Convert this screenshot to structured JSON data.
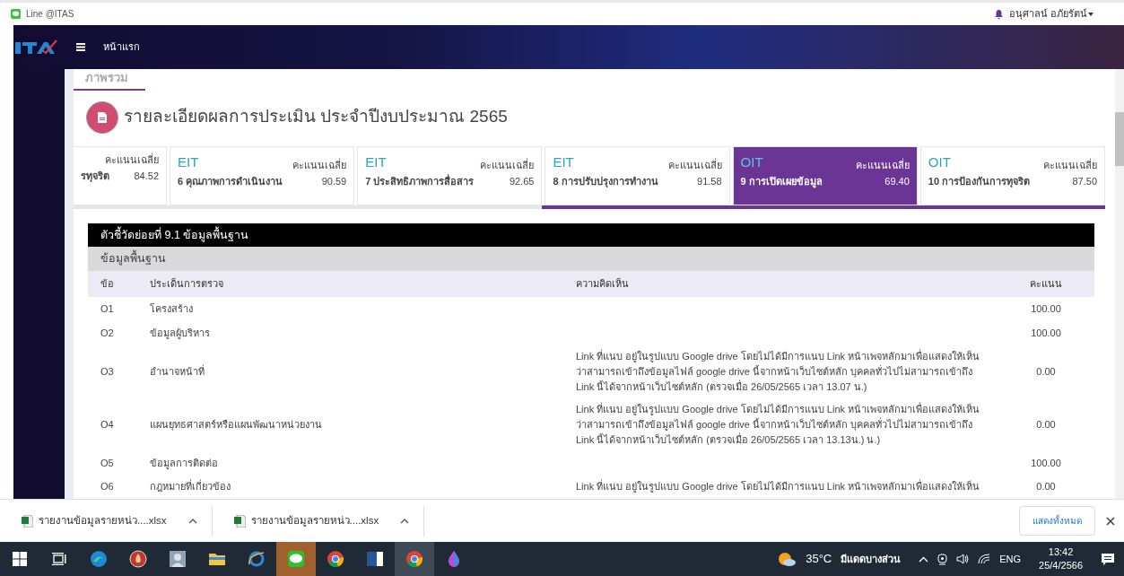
{
  "browser_bar": {
    "bookmark": "Line @ITAS",
    "user": "อนุศาลน์ อภัยรัตน์"
  },
  "navbar": {
    "menu": "หน้าแรก"
  },
  "tabs": [
    {
      "label": "ภาพรวม",
      "selected": true
    }
  ],
  "heading": "รายละเอียดผลการประเมิน ประจำปีงบประมาณ 2565",
  "cards": [
    {
      "name": "รทุจริต",
      "score_label": "คะแนนเฉลี่ย",
      "score": "84.52",
      "selected": false
    },
    {
      "kind_label": "EIT",
      "name": "6 คุณภาพการดำเนินงาน",
      "score_label": "คะแนนเฉลี่ย",
      "score": "90.59",
      "selected": false
    },
    {
      "kind_label": "EIT",
      "name": "7 ประสิทธิภาพการสื่อสาร",
      "score_label": "คะแนนเฉลี่ย",
      "score": "92.65",
      "selected": false
    },
    {
      "kind_label": "EIT",
      "name": "8 การปรับปรุงการทำงาน",
      "score_label": "คะแนนเฉลี่ย",
      "score": "91.58",
      "selected": false
    },
    {
      "kind_label": "OIT",
      "name": "9 การเปิดเผยข้อมูล",
      "score_label": "คะแนนเฉลี่ย",
      "score": "69.40",
      "selected": true
    },
    {
      "kind_label": "OIT",
      "name": "10 การป้องกันการทุจริต",
      "score_label": "คะแนนเฉลี่ย",
      "score": "87.50",
      "selected": false
    }
  ],
  "table": {
    "title": "ตัวชี้วัดย่อยที่ 9.1 ข้อมูลพื้นฐาน",
    "section": "ข้อมูลพื้นฐาน",
    "columns": [
      "ข้อ",
      "ประเด็นการตรวจ",
      "ความคิดเห็น",
      "คะแนน"
    ],
    "rows": [
      {
        "no": "O1",
        "topic": "โครงสร้าง",
        "score": "100.00"
      },
      {
        "no": "O2",
        "topic": "ข้อมูลผู้บริหาร",
        "score": "100.00"
      },
      {
        "no": "O3",
        "topic": "อำนาจหน้าที่",
        "comment": "Link ที่แนบ อยู่ในรูปแบบ Google drive โดยไม่ได้มีการแนบ Link หน้าเพจหลักมาเพื่อแสดงให้เห็นว่าสามารถเข้าถึงข้อมูลไฟล์ google drive นี้จากหน้าเว็บไซต์หลัก บุคคลทั่วไปไม่สามารถเข้าถึง Link นี้ได้จากหน้าเว็บไซต์หลัก (ตรวจเมื่อ 26/05/2565 เวลา 13.07 น.)",
        "score": "0.00"
      },
      {
        "no": "O4",
        "topic": "แผนยุทธศาสตร์หรือแผนพัฒนาหน่วยงาน",
        "comment": "Link ที่แนบ อยู่ในรูปแบบ Google drive โดยไม่ได้มีการแนบ Link หน้าเพจหลักมาเพื่อแสดงให้เห็นว่าสามารถเข้าถึงข้อมูลไฟล์ google drive นี้จากหน้าเว็บไซต์หลัก บุคคลทั่วไปไม่สามารถเข้าถึง Link นี้ได้จากหน้าเว็บไซต์หลัก (ตรวจเมื่อ 26/05/2565 เวลา 13.13น.) น.)",
        "score": "0.00"
      },
      {
        "no": "O5",
        "topic": "ข้อมูลการติดต่อ",
        "score": "100.00"
      },
      {
        "no": "O6",
        "topic": "กฎหมายที่เกี่ยวข้อง",
        "comment": "Link ที่แนบ อยู่ในรูปแบบ Google drive โดยไม่ได้มีการแนบ Link หน้าเพจหลักมาเพื่อแสดงให้เห็น",
        "score": "0.00"
      }
    ]
  },
  "downloads": [
    {
      "filename": "รายงานข้อมูลรายหน่ว....xlsx"
    },
    {
      "filename": "รายงานข้อมูลรายหน่ว....xlsx"
    }
  ],
  "show_all": "แสดงทั้งหมด",
  "taskbar": {
    "apps": [
      {
        "kind": "edge",
        "flashing": false,
        "selected": false
      },
      {
        "kind": "fire",
        "flashing": false,
        "selected": false
      },
      {
        "kind": "avatar",
        "flashing": false,
        "selected": false
      },
      {
        "kind": "folder",
        "flashing": false,
        "selected": false
      },
      {
        "kind": "ie",
        "flashing": false,
        "selected": false
      },
      {
        "kind": "line",
        "flashing": true,
        "selected": false
      },
      {
        "kind": "chrome",
        "flashing": false,
        "selected": false
      },
      {
        "kind": "word",
        "flashing": false,
        "selected": false
      },
      {
        "kind": "chrome",
        "flashing": false,
        "selected": true
      },
      {
        "kind": "drop",
        "flashing": false,
        "selected": false
      }
    ],
    "temperature": "35°C",
    "weather": "มีแดดบางส่วน",
    "language": "ENG",
    "time": "13:42",
    "date": "25/4/2566"
  }
}
